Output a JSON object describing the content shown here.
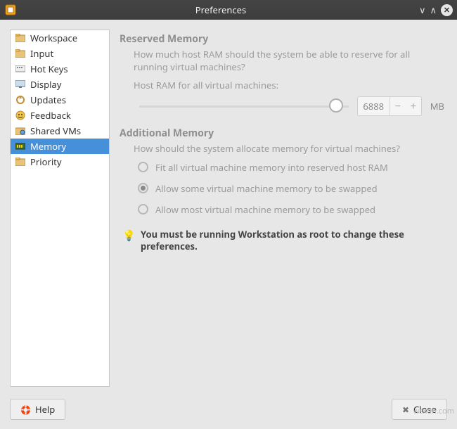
{
  "window": {
    "title": "Preferences"
  },
  "sidebar": {
    "items": [
      {
        "label": "Workspace",
        "icon": "folder-icon"
      },
      {
        "label": "Input",
        "icon": "folder-icon"
      },
      {
        "label": "Hot Keys",
        "icon": "keyboard-icon"
      },
      {
        "label": "Display",
        "icon": "monitor-icon"
      },
      {
        "label": "Updates",
        "icon": "updates-icon"
      },
      {
        "label": "Feedback",
        "icon": "feedback-icon"
      },
      {
        "label": "Shared VMs",
        "icon": "shared-icon"
      },
      {
        "label": "Memory",
        "icon": "memory-icon",
        "selected": true
      },
      {
        "label": "Priority",
        "icon": "priority-icon"
      }
    ]
  },
  "reserved": {
    "title": "Reserved Memory",
    "desc": "How much host RAM should the system be able to reserve for all running virtual machines?",
    "slider_label": "Host RAM for all virtual machines:",
    "value": "6888",
    "unit": "MB"
  },
  "additional": {
    "title": "Additional Memory",
    "desc": "How should the system allocate memory for virtual machines?",
    "options": [
      {
        "label": "Fit all virtual machine memory into reserved host RAM",
        "selected": false
      },
      {
        "label": "Allow some virtual machine memory to be swapped",
        "selected": true
      },
      {
        "label": "Allow most virtual machine memory to be swapped",
        "selected": false
      }
    ]
  },
  "note": {
    "text": "You must be running Workstation as root to change these preferences."
  },
  "footer": {
    "help_label": "Help",
    "close_label": "Close"
  },
  "watermark": "wsxdn.com"
}
